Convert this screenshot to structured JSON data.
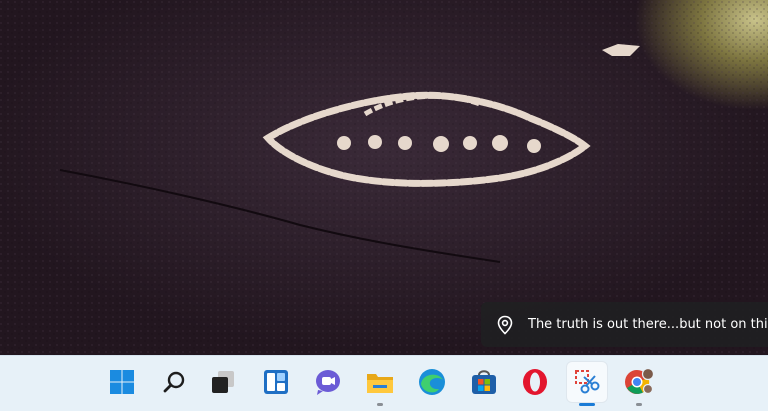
{
  "desktop": {
    "spotlight": {
      "icon": "location-pin-icon",
      "text": "The truth is out there...but not on this planet"
    }
  },
  "taskbar": {
    "items": [
      {
        "icon": "windows-start-icon",
        "running": false
      },
      {
        "icon": "search-icon",
        "running": false
      },
      {
        "icon": "task-view-icon",
        "running": false
      },
      {
        "icon": "widgets-icon",
        "running": false
      },
      {
        "icon": "teams-chat-icon",
        "running": false
      },
      {
        "icon": "file-explorer-icon",
        "running": true
      },
      {
        "icon": "edge-browser-icon",
        "running": false
      },
      {
        "icon": "microsoft-store-icon",
        "running": false
      },
      {
        "icon": "opera-browser-icon",
        "running": false
      },
      {
        "icon": "snipping-tool-icon",
        "running": true,
        "active": true
      },
      {
        "icon": "chrome-profile-icon",
        "running": true
      }
    ]
  },
  "colors": {
    "taskbar_bg": "#e7f1f8",
    "active_indicator": "#1a7bd6",
    "spotlight_bg": "#202022"
  }
}
